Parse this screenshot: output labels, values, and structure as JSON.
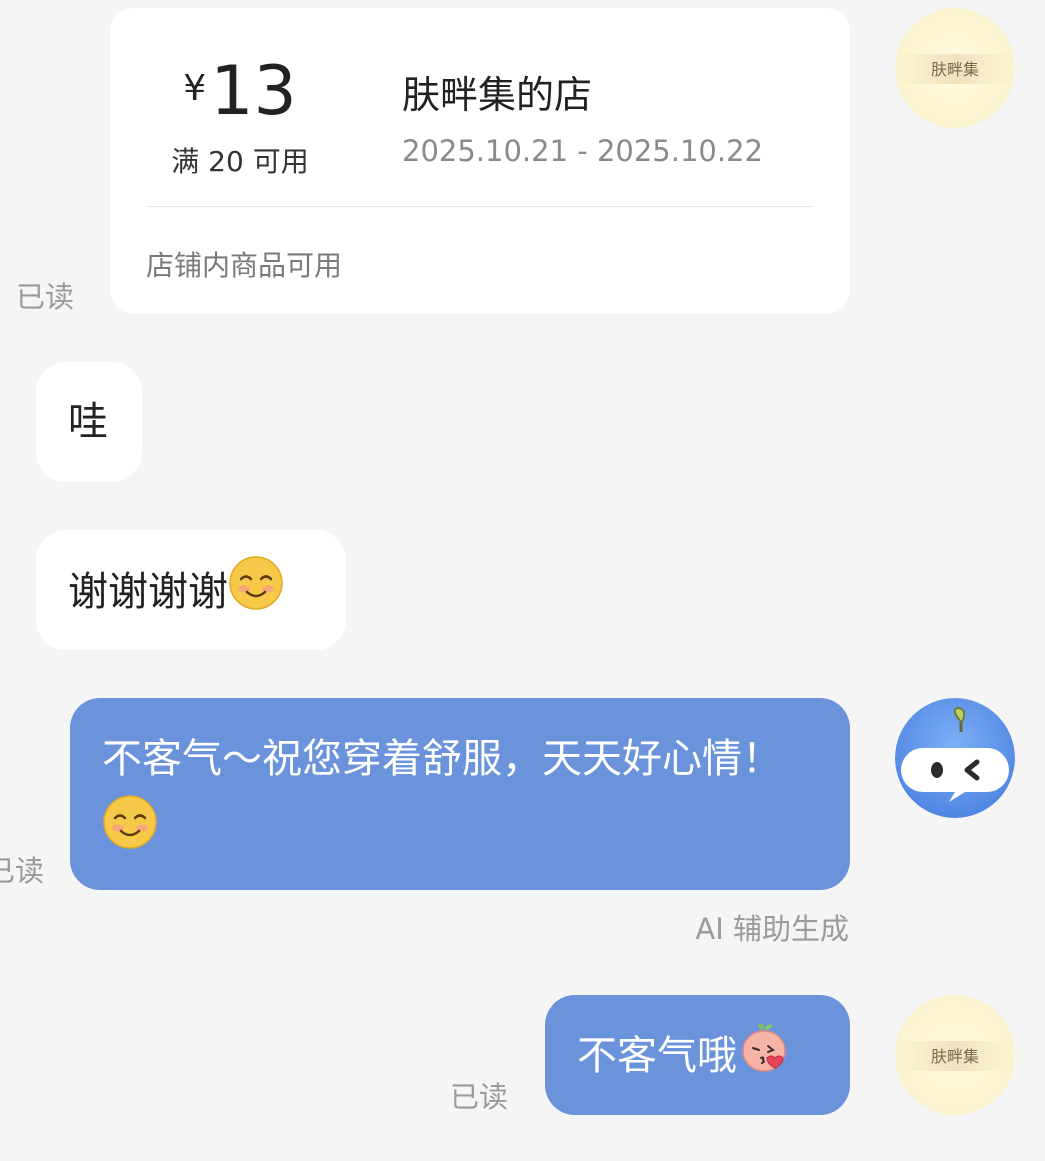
{
  "coupon": {
    "currency": "¥",
    "amount": "13",
    "condition": "满 20 可用",
    "shop_name": "肤畔集的店",
    "date_range": "2025.10.21 - 2025.10.22",
    "scope": "店铺内商品可用",
    "read_status": "已读"
  },
  "shop_avatar_text": "肤畔集",
  "messages": [
    {
      "side": "left",
      "text": "哇"
    },
    {
      "side": "left",
      "text": "谢谢谢谢",
      "emoji": "smiling-face-icon"
    },
    {
      "side": "right",
      "text": "不客气～祝您穿着舒服，天天好心情！",
      "emoji": "smiling-face-icon",
      "read_status": "已读",
      "note": "AI 辅助生成"
    },
    {
      "side": "right",
      "text": "不客气哦",
      "emoji": "kiss-peach-icon",
      "read_status": "已读"
    }
  ],
  "colors": {
    "background": "#f5f5f5",
    "bubble_right": "#6b93dc",
    "bubble_left": "#ffffff",
    "muted_text": "#9b9b9b"
  }
}
